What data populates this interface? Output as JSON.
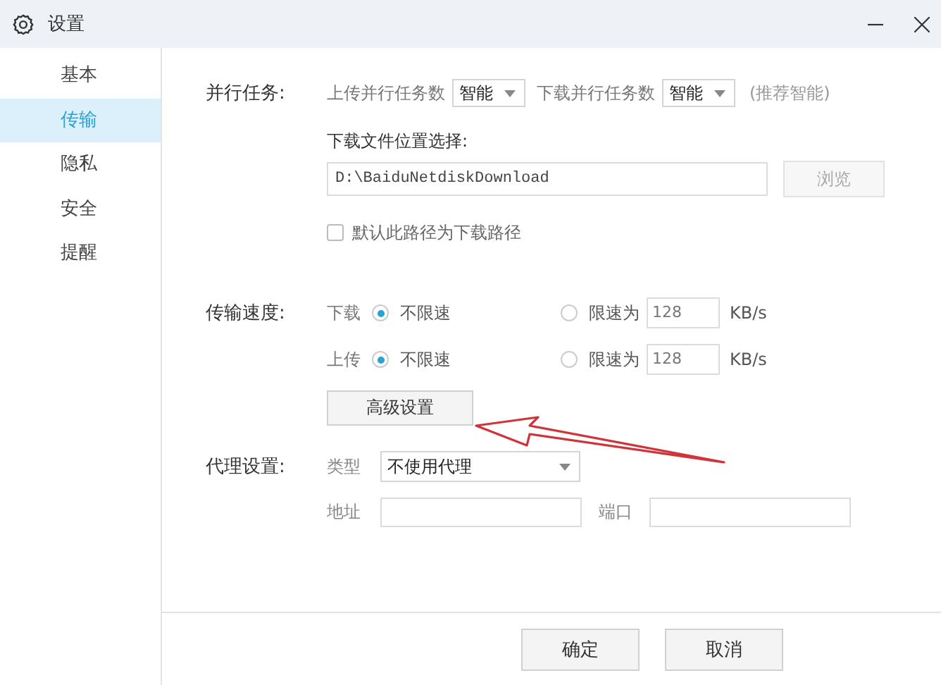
{
  "window": {
    "title": "设置"
  },
  "sidebar": {
    "items": [
      {
        "label": "基本",
        "selected": false
      },
      {
        "label": "传输",
        "selected": true
      },
      {
        "label": "隐私",
        "selected": false
      },
      {
        "label": "安全",
        "selected": false
      },
      {
        "label": "提醒",
        "selected": false
      }
    ]
  },
  "parallel_tasks": {
    "label": "并行任务:",
    "upload_label": "上传并行任务数",
    "upload_value": "智能",
    "download_label": "下载并行任务数",
    "download_value": "智能",
    "hint": "(推荐智能)"
  },
  "download_location": {
    "label": "下载文件位置选择:",
    "path": "D:\\BaiduNetdiskDownload",
    "browse_button": {
      "label": "浏览",
      "disabled": true
    },
    "default_checkbox": {
      "label": "默认此路径为下载路径",
      "checked": false
    }
  },
  "speed": {
    "label": "传输速度:",
    "rows": [
      {
        "direction": "下载",
        "options": [
          {
            "label": "不限速",
            "selected": true
          },
          {
            "label": "限速为",
            "selected": false,
            "value": "128",
            "unit": "KB/s"
          }
        ]
      },
      {
        "direction": "上传",
        "options": [
          {
            "label": "不限速",
            "selected": true
          },
          {
            "label": "限速为",
            "selected": false,
            "value": "128",
            "unit": "KB/s"
          }
        ]
      }
    ],
    "advanced_button": "高级设置"
  },
  "proxy": {
    "label": "代理设置:",
    "type_label": "类型",
    "type_value": "不使用代理",
    "address_label": "地址",
    "port_label": "端口"
  },
  "buttons": [
    "确定",
    "取消"
  ]
}
